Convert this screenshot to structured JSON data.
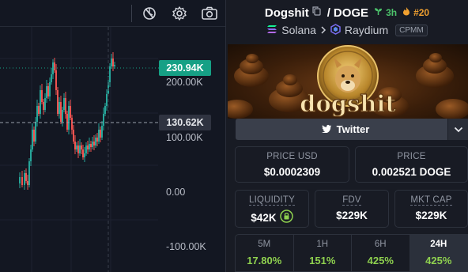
{
  "chart": {
    "price_axis": [
      "200.00K",
      "100.00K",
      "0.00",
      "-100.00K"
    ],
    "current_price_tag": "230.94K",
    "crosshair_price_tag": "130.62K",
    "colors": {
      "up": "#26a69a",
      "down": "#ef5350",
      "current": "#16a085"
    }
  },
  "toolbar": {
    "icons": [
      "compare-icon",
      "settings-gear-icon",
      "camera-icon"
    ]
  },
  "pair": {
    "base": "Dogshit",
    "separator": "/",
    "quote": "DOGE",
    "age": "3h",
    "rank": "#20",
    "chain": "Solana",
    "dex": "Raydium",
    "pool_type": "CPMM"
  },
  "banner": {
    "logo_text": "dogshit"
  },
  "social": {
    "twitter_label": "Twitter"
  },
  "stats": {
    "price_usd_label": "PRICE USD",
    "price_usd": "$0.0002309",
    "price_native_label": "PRICE",
    "price_native": "0.002521 DOGE",
    "liquidity_label": "LIQUIDITY",
    "liquidity": "$42K",
    "fdv_label": "FDV",
    "fdv": "$229K",
    "mcap_label": "MKT CAP",
    "mcap": "$229K"
  },
  "timeframes": [
    {
      "label": "5M",
      "value": "17.80%"
    },
    {
      "label": "1H",
      "value": "151%"
    },
    {
      "label": "6H",
      "value": "425%"
    },
    {
      "label": "24H",
      "value": "425%"
    }
  ]
}
